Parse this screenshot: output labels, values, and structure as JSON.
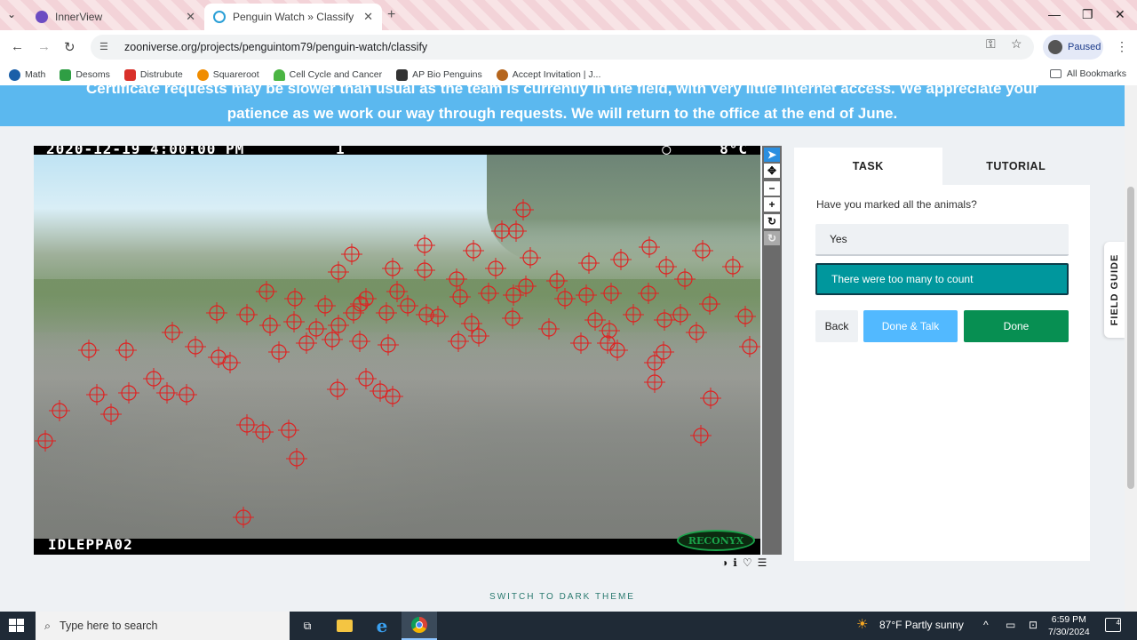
{
  "browser": {
    "tabs": [
      {
        "title": "InnerView",
        "active": false
      },
      {
        "title": "Penguin Watch » Classify — Zo",
        "active": true
      }
    ],
    "url": "zooniverse.org/projects/penguintom79/penguin-watch/classify",
    "profile_status": "Paused",
    "bookmarks": [
      "Math",
      "Desoms",
      "Distrubute",
      "Squareroot",
      "Cell Cycle and Cancer",
      "AP Bio Penguins",
      "Accept Invitation | J..."
    ],
    "all_bookmarks": "All Bookmarks"
  },
  "banner": {
    "line1": "Certificate requests may be slower than usual as the team is currently in the field, with very little internet access. We appreciate your",
    "line2": "patience as we work our way through requests. We will return to the office at the end of June."
  },
  "camera": {
    "timestamp": "2020-12-19 4:00:00 PM",
    "marker_count_symbol": "1",
    "temperature": "8°C",
    "moon": "◯",
    "camera_id": "IDLEPPA02",
    "brand": "RECONYX"
  },
  "markers": {
    "count": 108,
    "color": "#e02020"
  },
  "panel": {
    "tabs": [
      "TASK",
      "TUTORIAL"
    ],
    "question": "Have you marked all the animals?",
    "answers": [
      "Yes",
      "There were too many to count"
    ],
    "selected_answer": "There were too many to count",
    "buttons": {
      "back": "Back",
      "done_talk": "Done & Talk",
      "done": "Done"
    }
  },
  "field_guide": "FIELD GUIDE",
  "footer": {
    "dark_theme": "SWITCH TO DARK THEME"
  },
  "taskbar": {
    "search_placeholder": "Type here to search",
    "weather": "87°F  Partly sunny",
    "time": "6:59 PM",
    "date": "7/30/2024",
    "notifications": "4"
  },
  "colors": {
    "banner": "#5bb8ef",
    "selected_answer": "#00979d",
    "done": "#078f52",
    "done_talk": "#52b9ff"
  }
}
